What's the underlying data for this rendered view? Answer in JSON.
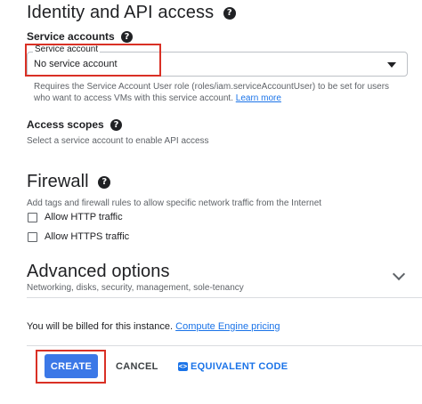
{
  "identity": {
    "title": "Identity and API access",
    "service_accounts_label": "Service accounts",
    "select_label": "Service account",
    "select_value": "No service account",
    "hint_line1": "Requires the Service Account User role (roles/iam.serviceAccountUser) to be set for users",
    "hint_line2_prefix": "who want to access VMs with this service account.",
    "learn_more": "Learn more",
    "access_scopes_label": "Access scopes",
    "access_scopes_hint": "Select a service account to enable API access"
  },
  "firewall": {
    "title": "Firewall",
    "hint": "Add tags and firewall rules to allow specific network traffic from the Internet",
    "options": [
      {
        "label": "Allow HTTP traffic",
        "checked": false
      },
      {
        "label": "Allow HTTPS traffic",
        "checked": false
      }
    ]
  },
  "advanced": {
    "title": "Advanced options",
    "hint": "Networking, disks, security, management, sole-tenancy"
  },
  "billing": {
    "text": "You will be billed for this instance.",
    "link": "Compute Engine pricing"
  },
  "actions": {
    "create": "CREATE",
    "cancel": "CANCEL",
    "equivalent_code": "EQUIVALENT CODE"
  },
  "colors": {
    "accent": "#1a73e8",
    "create_bg": "#3b78e7",
    "highlight": "#d93025"
  },
  "icons": {
    "help": "help-circle-icon",
    "dropdown": "caret-down-icon",
    "expand": "chevron-down-icon",
    "code": "code-icon"
  }
}
